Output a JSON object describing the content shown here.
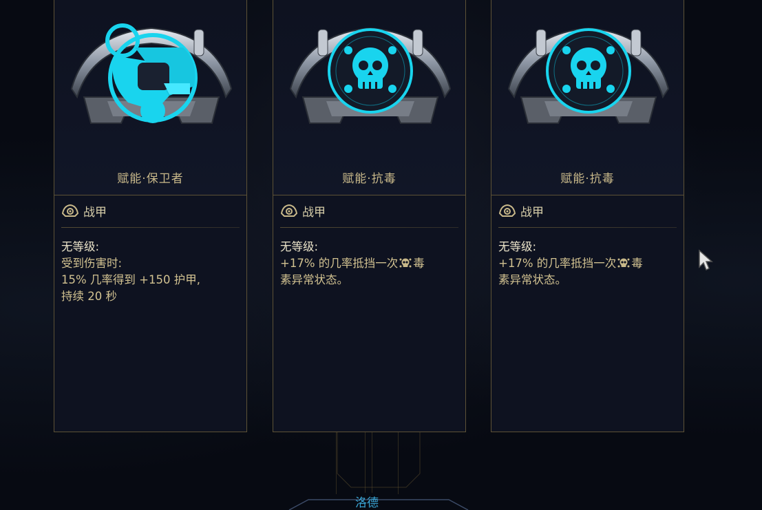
{
  "colors": {
    "card_bg": "#0e1220",
    "card_border": "#5d5236",
    "title_text": "#c9b98a",
    "desc_text": "#d2c291",
    "cyan_glow": "#19d4ee",
    "bottom_label": "#3aa6d6"
  },
  "cards": [
    {
      "title": "赋能·保卫者",
      "emblem_icon": "guardian-arcane-icon",
      "type_icon": "warframe-helmet-icon",
      "type_label": "战甲",
      "rank_label": "无等级:",
      "lines": [
        "受到伤害时:",
        "15% 几率得到 +150 护甲,",
        "持续 20 秒"
      ]
    },
    {
      "title": "赋能·抗毒",
      "emblem_icon": "skull-toxin-icon",
      "type_icon": "warframe-helmet-icon",
      "type_label": "战甲",
      "rank_label": "无等级:",
      "line1_before": "+17% 的几率抵挡一次",
      "line1_icon": "toxin-skull-icon",
      "line1_after": "毒",
      "line2": "素异常状态。"
    },
    {
      "title": "赋能·抗毒",
      "emblem_icon": "skull-toxin-icon",
      "type_icon": "warframe-helmet-icon",
      "type_label": "战甲",
      "rank_label": "无等级:",
      "line1_before": "+17% 的几率抵挡一次",
      "line1_icon": "toxin-skull-icon",
      "line1_after": "毒",
      "line2": "素异常状态。"
    }
  ],
  "bottom": {
    "label": "洛德"
  }
}
